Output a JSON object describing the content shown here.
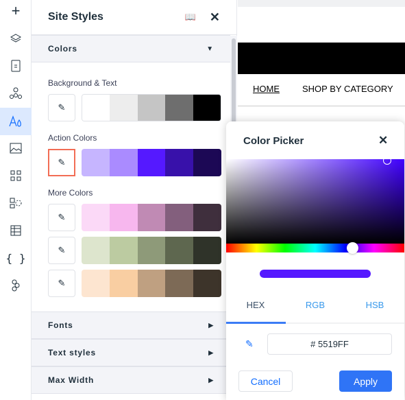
{
  "iconbar": {
    "items": [
      "add",
      "layers",
      "pages",
      "connections",
      "site-styles",
      "media",
      "apps",
      "components",
      "cms",
      "code",
      "design-tokens"
    ],
    "active": "site-styles"
  },
  "panel": {
    "title": "Site Styles",
    "colors_section": "Colors",
    "bg_label": "Background & Text",
    "action_label": "Action Colors",
    "more_label": "More Colors",
    "bg_colors": [
      "#FFFFFF",
      "#EDEDED",
      "#C5C5C5",
      "#6E6E6E",
      "#000000"
    ],
    "action_colors": [
      "#C6B5FF",
      "#AA8BFF",
      "#5519FF",
      "#3811AA",
      "#1C0855"
    ],
    "more_colors": [
      [
        "#FBD9F7",
        "#F7B7EE",
        "#C08AB4",
        "#835F7D",
        "#3F2F3D"
      ],
      [
        "#DDE5CD",
        "#BCCBA1",
        "#8E9A79",
        "#5E674F",
        "#2F3329"
      ],
      [
        "#FDE5D0",
        "#F9CEA2",
        "#BFA081",
        "#7D6A56",
        "#3D342A"
      ]
    ],
    "sections": [
      "Fonts",
      "Text styles",
      "Max Width"
    ]
  },
  "site": {
    "nav": [
      "HOME",
      "SHOP BY CATEGORY"
    ]
  },
  "picker": {
    "title": "Color Picker",
    "tabs": [
      "HEX",
      "RGB",
      "HSB"
    ],
    "active_tab": "HEX",
    "hex_value": "# 5519FF",
    "selected_color": "#5519FF",
    "cancel": "Cancel",
    "apply": "Apply"
  }
}
